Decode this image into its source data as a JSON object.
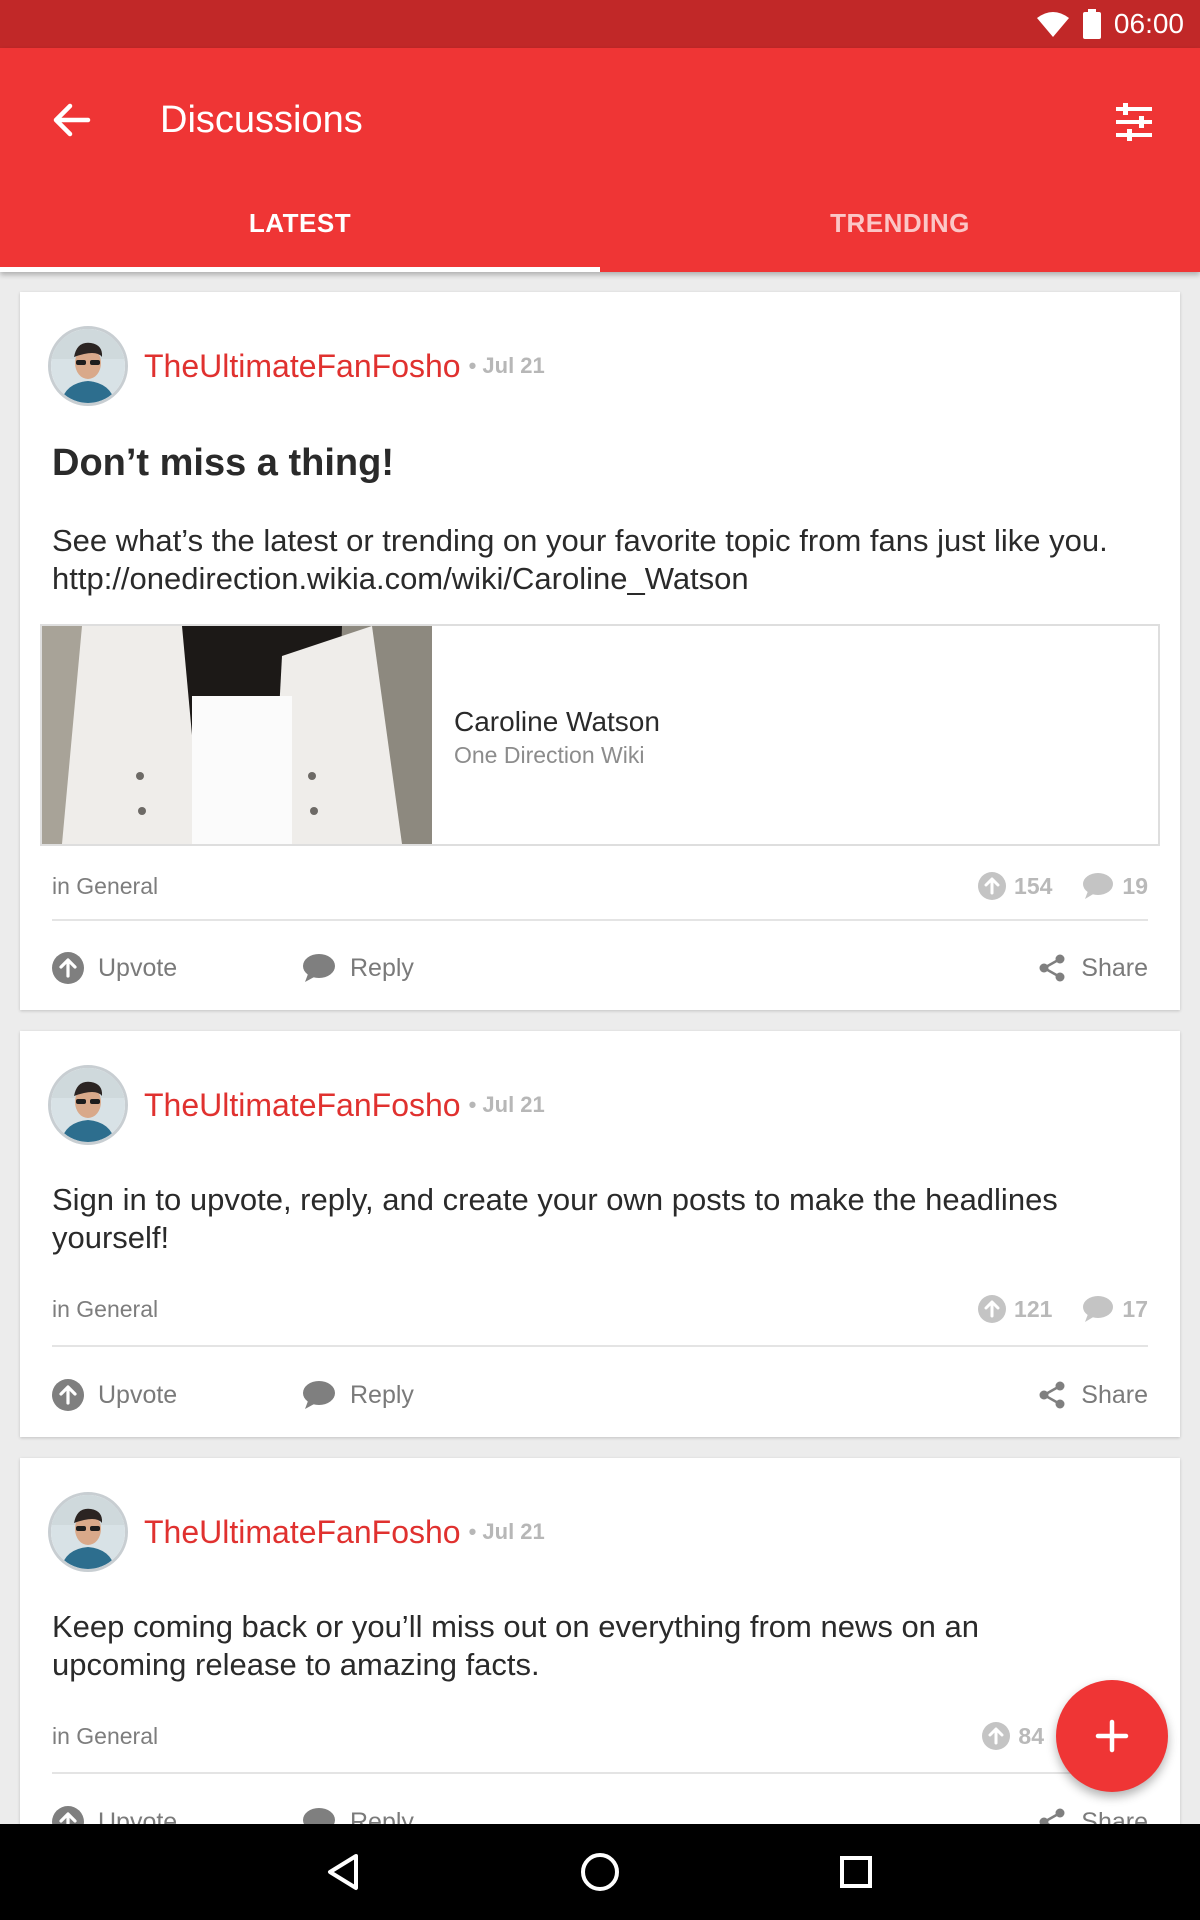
{
  "status_bar": {
    "time": "06:00",
    "icons": [
      "wifi-icon",
      "battery-icon"
    ]
  },
  "app_bar": {
    "title": "Discussions",
    "back_icon": "arrow-back-icon",
    "filter_icon": "tune-sliders-icon",
    "color": "#ef3535"
  },
  "tabs": [
    {
      "label": "LATEST",
      "active": true
    },
    {
      "label": "TRENDING",
      "active": false
    }
  ],
  "posts": [
    {
      "author": "TheUltimateFanFosho",
      "date": "• Jul 21",
      "title": "Don’t miss a thing!",
      "body_lines": [
        "See what’s the latest or trending on your favorite topic from fans just like you.",
        "http://onedirection.wikia.com/wiki/Caroline_Watson"
      ],
      "link_preview": {
        "title": "Caroline Watson",
        "source": "One Direction Wiki"
      },
      "category": "in General",
      "upvotes": "154",
      "comments": "19",
      "actions": {
        "upvote": "Upvote",
        "reply": "Reply",
        "share": "Share"
      }
    },
    {
      "author": "TheUltimateFanFosho",
      "date": "• Jul 21",
      "body_lines": [
        "Sign in to upvote, reply, and create your own posts to make the headlines",
        "yourself!"
      ],
      "category": "in General",
      "upvotes": "121",
      "comments": "17",
      "actions": {
        "upvote": "Upvote",
        "reply": "Reply",
        "share": "Share"
      }
    },
    {
      "author": "TheUltimateFanFosho",
      "date": "• Jul 21",
      "body_lines": [
        "Keep coming back or you’ll miss out on everything from news on an",
        "upcoming release to amazing facts."
      ],
      "category": "in General",
      "upvotes": "84",
      "actions": {
        "upvote": "Upvote",
        "reply": "Reply",
        "share": "Share"
      }
    }
  ],
  "fab": {
    "icon": "plus-icon"
  },
  "nav_bar": {
    "icons": [
      "back-triangle-icon",
      "home-circle-icon",
      "recents-square-icon"
    ]
  }
}
